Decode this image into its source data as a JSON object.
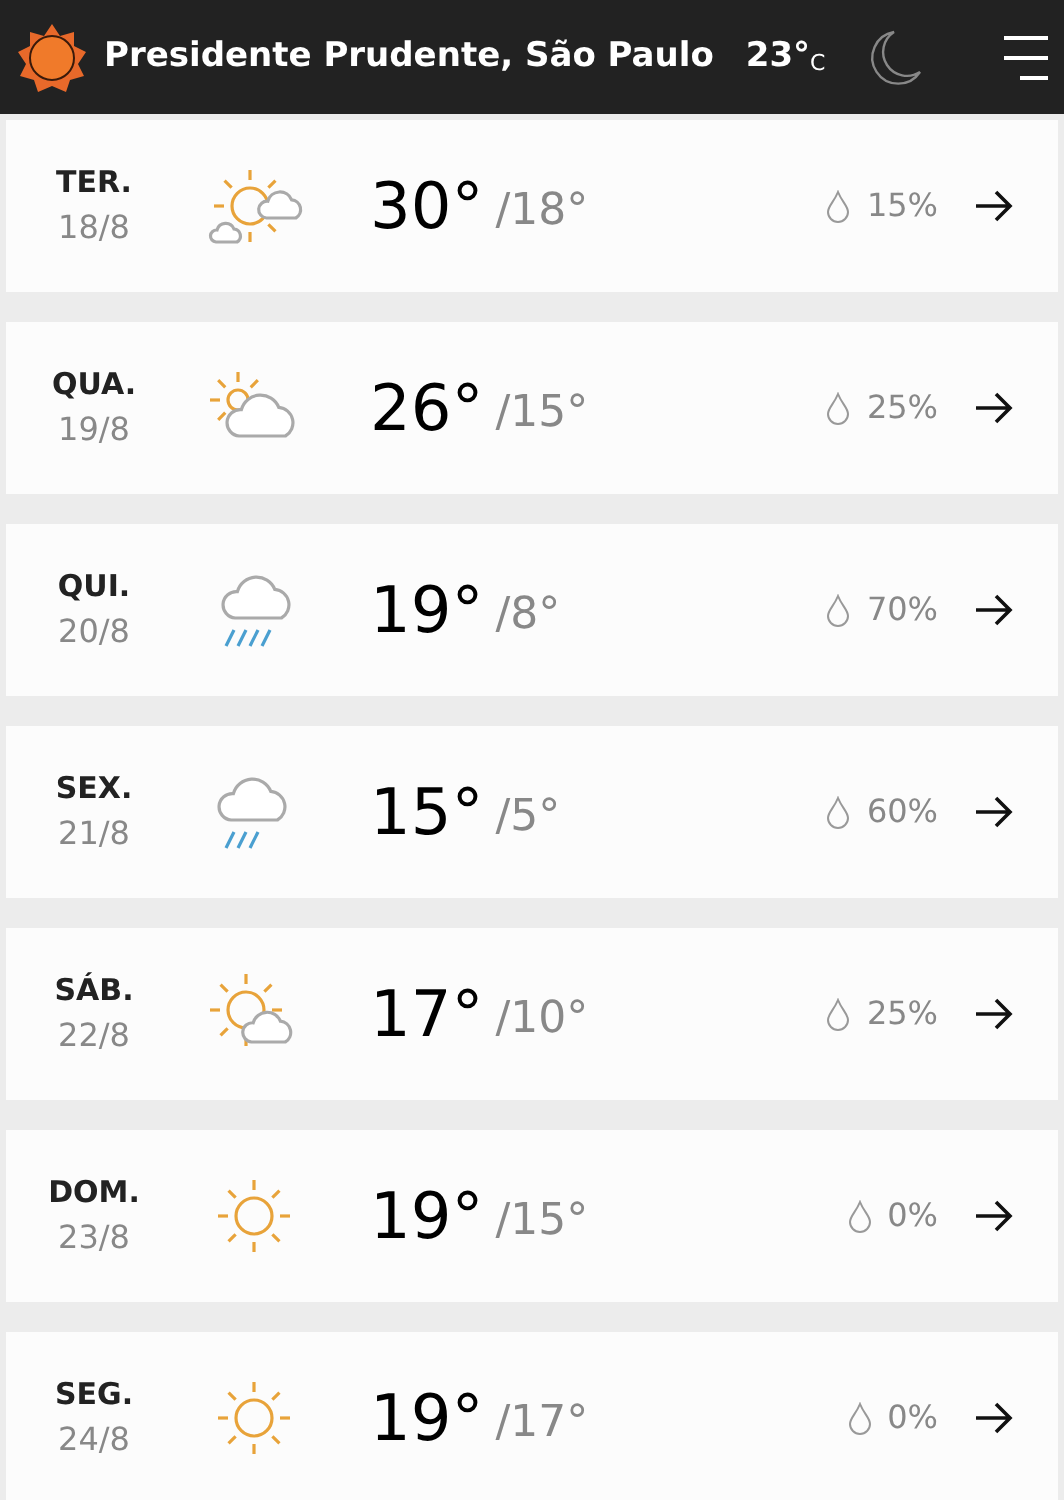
{
  "header": {
    "location": "Presidente Prudente, São Paulo",
    "temperature": "23°",
    "unit": "C"
  },
  "days": [
    {
      "weekday": "TER.",
      "date": "18/8",
      "kind": "sunclouds",
      "high": "30°",
      "low": "/18°",
      "rain": "15%"
    },
    {
      "weekday": "QUA.",
      "date": "19/8",
      "kind": "cloudy",
      "high": "26°",
      "low": "/15°",
      "rain": "25%"
    },
    {
      "weekday": "QUI.",
      "date": "20/8",
      "kind": "rain",
      "high": "19°",
      "low": "/8°",
      "rain": "70%"
    },
    {
      "weekday": "SEX.",
      "date": "21/8",
      "kind": "showers",
      "high": "15°",
      "low": "/5°",
      "rain": "60%"
    },
    {
      "weekday": "SÁB.",
      "date": "22/8",
      "kind": "mixed",
      "high": "17°",
      "low": "/10°",
      "rain": "25%"
    },
    {
      "weekday": "DOM.",
      "date": "23/8",
      "kind": "sunny",
      "high": "19°",
      "low": "/15°",
      "rain": "0%"
    },
    {
      "weekday": "SEG.",
      "date": "24/8",
      "kind": "sunny",
      "high": "19°",
      "low": "/17°",
      "rain": "0%"
    }
  ]
}
